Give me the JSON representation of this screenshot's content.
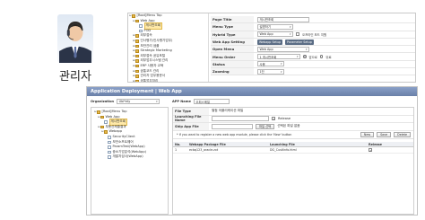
{
  "admin": {
    "label": "관리자",
    "icon": "admin-user-icon"
  },
  "top_window": {
    "tree": [
      {
        "label": "[Root]Menu Top",
        "depth": 0,
        "type": "folder",
        "toggle": "⊟"
      },
      {
        "label": "Web App",
        "depth": 1,
        "type": "folder",
        "toggle": "⊟"
      },
      {
        "label": "게시판조회",
        "depth": 2,
        "type": "page",
        "selected": true
      },
      {
        "label": "FOD",
        "depth": 2,
        "type": "page"
      },
      {
        "label": "외부접속",
        "depth": 1,
        "type": "folder",
        "toggle": "⊞"
      },
      {
        "label": "인사평가(인사평가업무)",
        "depth": 1,
        "type": "folder",
        "toggle": "⊞"
      },
      {
        "label": "보안관리 샘플",
        "depth": 1,
        "type": "folder",
        "toggle": "⊞"
      },
      {
        "label": "Strategic Marketing",
        "depth": 1,
        "type": "folder",
        "toggle": "⊞"
      },
      {
        "label": "외부접속 공유포털",
        "depth": 1,
        "type": "folder",
        "toggle": "⊞"
      },
      {
        "label": "외부업무시스템 관리",
        "depth": 1,
        "type": "folder",
        "toggle": "⊞"
      },
      {
        "label": "ERP 사용자 교육",
        "depth": 1,
        "type": "folder",
        "toggle": "⊞"
      },
      {
        "label": "공통코드 관리",
        "depth": 1,
        "type": "folder",
        "toggle": "⊞"
      },
      {
        "label": "관리자 업무용문서",
        "depth": 1,
        "type": "folder",
        "toggle": "⊞"
      },
      {
        "label": "공통업무처리",
        "depth": 1,
        "type": "folder",
        "toggle": "⊞"
      }
    ],
    "form": {
      "page_title": {
        "label": "Page Title",
        "value": "게시판조회"
      },
      "menu_type": {
        "label": "Menu Type",
        "value": "설명하기"
      },
      "hybrid_type": {
        "label": "Hybrid Type",
        "value": "Web App",
        "check_label": "오프라인 모드 지원"
      },
      "web_app_setting": {
        "label": "Web App Setting",
        "btn1": "Webapp Setup",
        "btn2": "Parameter Setup"
      },
      "open_menu": {
        "label": "Open Menu",
        "value": "Web App"
      },
      "menu_order": {
        "label": "Menu Order",
        "value": "1 게시판조회",
        "radio1": "앞으로",
        "radio2": "뒤로"
      },
      "status": {
        "label": "Status",
        "value": "사용"
      },
      "zooming": {
        "label": "Zooming",
        "value": "1단"
      }
    }
  },
  "bottom_window": {
    "title": "Application Deployment | Web App",
    "organization": {
      "label": "Organization",
      "value": "Ubi*ety"
    },
    "app_name": {
      "label": "APP Name",
      "value": "오피스메일"
    },
    "tree": [
      {
        "label": "[Root]Menu Top",
        "depth": 0,
        "type": "folder",
        "toggle": "⊟"
      },
      {
        "label": "Web App",
        "depth": 1,
        "type": "folder",
        "toggle": "⊟"
      },
      {
        "label": "게시판조회",
        "depth": 2,
        "type": "page",
        "selected": true
      },
      {
        "label": "부동산제출결과",
        "depth": 1,
        "type": "folder",
        "toggle": "⊟"
      },
      {
        "label": "Webapp",
        "depth": 2,
        "type": "folder",
        "toggle": "⊟"
      },
      {
        "label": "SecurityClient",
        "depth": 3,
        "type": "page"
      },
      {
        "label": "보안소프트웨어",
        "depth": 3,
        "type": "page"
      },
      {
        "label": "ParamTest(WebApp)",
        "depth": 3,
        "type": "page"
      },
      {
        "label": "중소기업분석(WebApp)",
        "depth": 3,
        "type": "page"
      },
      {
        "label": "개발자검사(WebApp)",
        "depth": 3,
        "type": "page"
      }
    ],
    "file_type": {
      "label": "File Type",
      "value": "별첨 어플리케이션 파일"
    },
    "launching_file": {
      "label": "Launching File Name",
      "value": "",
      "check_label": "Release"
    },
    "ship_app_file": {
      "label": "Ship App File",
      "value": "",
      "browse_label": "파일 선택",
      "browse_hint": "선택된 파일 없음"
    },
    "hint": {
      "text": "* If you want to register a new web app module, please click the 'New' button",
      "new": "New",
      "save": "Save",
      "delete": "Delete"
    },
    "table": {
      "headers": [
        "No.",
        "Webapp Package File",
        "Launching File",
        "Release"
      ],
      "rows": [
        {
          "no": "1",
          "package": "ecbq123_oracle.zxt",
          "launch": "DG_Custlinfo.html",
          "release": true
        }
      ]
    }
  }
}
